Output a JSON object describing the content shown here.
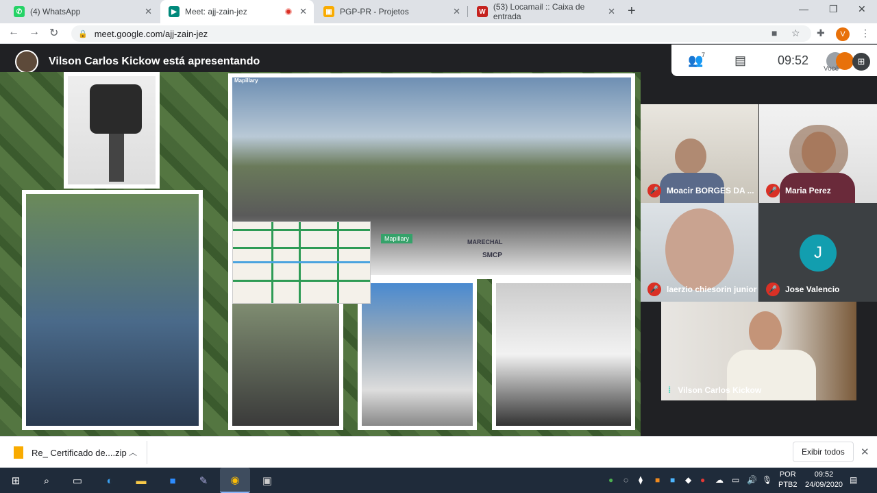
{
  "browser": {
    "tabs": [
      {
        "label": "(4) WhatsApp",
        "favicon": "whatsapp-icon",
        "color": "#25d366"
      },
      {
        "label": "Meet: ajj-zain-jez",
        "favicon": "meet-icon",
        "color": "#00897b"
      },
      {
        "label": "PGP-PR - Projetos",
        "favicon": "box-icon",
        "color": "#f9ab00"
      },
      {
        "label": "(53) Locamail :: Caixa de entrada",
        "favicon": "locamail-icon",
        "color": "#c5221f"
      }
    ],
    "url": "meet.google.com/ajj-zain-jez",
    "profile_initial": "V"
  },
  "meet": {
    "presenter_text": "Vilson Carlos Kickow está apresentando",
    "clock": "09:52",
    "participant_count": "7",
    "you_label": "Você",
    "participants": [
      {
        "name": "Moacir BORGES DA ...",
        "muted": true
      },
      {
        "name": "Maria Perez",
        "muted": true
      },
      {
        "name": "laerzio chiesorin junior",
        "muted": true
      },
      {
        "name": "Jose Valencio",
        "muted": true,
        "initial": "J"
      },
      {
        "name": "Vilson Carlos Kickow",
        "muted": false
      }
    ],
    "slide": {
      "map_brand": "Mapillary",
      "car_label": "Mapillary",
      "car_sign_1": "MARECHAL",
      "car_sign_2": "SMCP"
    }
  },
  "downloads": {
    "file": "Re_ Certificado de....zip",
    "show_all": "Exibir todos"
  },
  "taskbar": {
    "lang_1": "POR",
    "lang_2": "PTB2",
    "time": "09:52",
    "date": "24/09/2020"
  }
}
